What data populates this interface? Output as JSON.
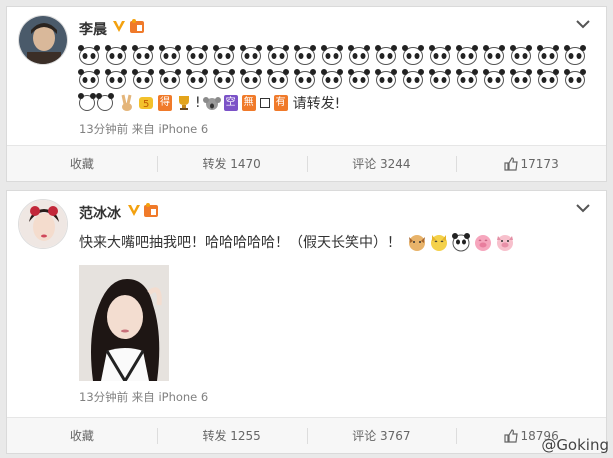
{
  "posts": [
    {
      "username": "李晨",
      "line1_emoji_count": 19,
      "line2_emoji_count": 19,
      "line3_tail": "请转发!",
      "line3_tags": [
        "得",
        "空",
        "無",
        "有"
      ],
      "meta": "13分钟前 来自 iPhone 6",
      "actions": {
        "favorite": "收藏",
        "repost": "转发 1470",
        "comment": "评论 3244",
        "like": "17173"
      }
    },
    {
      "username": "范冰冰",
      "text": "快来大嘴吧抽我吧！哈哈哈哈哈！（假天长笑中）！",
      "meta": "13分钟前 来自 iPhone 6",
      "actions": {
        "favorite": "收藏",
        "repost": "转发 1255",
        "comment": "评论 3767",
        "like": "18796"
      }
    }
  ],
  "watermark": "@Goking",
  "colors": {
    "vbadge": "#f3a10f",
    "tag_orange": "#f07a2a",
    "tag_purple": "#7b52c7"
  }
}
